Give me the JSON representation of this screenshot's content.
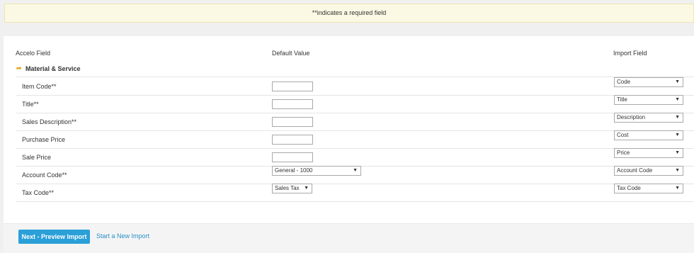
{
  "notice": "**indicates a required field",
  "headers": {
    "field": "Accelo Field",
    "default": "Default Value",
    "import": "Import Field"
  },
  "section": "Material & Service",
  "rows": [
    {
      "label": "Item Code**",
      "default_type": "text",
      "default_value": "",
      "import_value": "Code"
    },
    {
      "label": "Title**",
      "default_type": "text",
      "default_value": "",
      "import_value": "Title"
    },
    {
      "label": "Sales Description**",
      "default_type": "text",
      "default_value": "",
      "import_value": "Description"
    },
    {
      "label": "Purchase Price",
      "default_type": "text",
      "default_value": "",
      "import_value": "Cost"
    },
    {
      "label": "Sale Price",
      "default_type": "text",
      "default_value": "",
      "import_value": "Price"
    },
    {
      "label": "Account Code**",
      "default_type": "select",
      "default_value": "General - 1000",
      "import_value": "Account Code"
    },
    {
      "label": "Tax Code**",
      "default_type": "select",
      "default_value": "Sales Tax",
      "import_value": "Tax Code"
    }
  ],
  "footer": {
    "primary_button": "Next - Preview Import",
    "link": "Start a New Import"
  },
  "icons": {
    "section": "folder-arrow-icon",
    "select_caret": "caret-down-icon"
  },
  "colors": {
    "primary": "#2a9fd8",
    "link": "#2a8fc7",
    "notice_bg": "#fbf9e3"
  }
}
